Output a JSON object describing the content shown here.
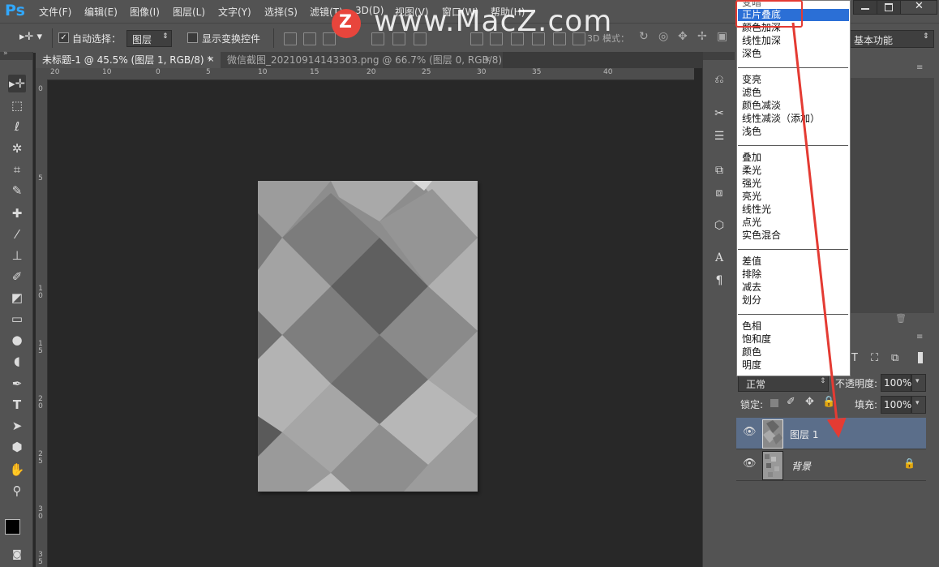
{
  "app": {
    "logo": "Ps"
  },
  "menu": [
    "文件(F)",
    "编辑(E)",
    "图像(I)",
    "图层(L)",
    "文字(Y)",
    "选择(S)",
    "滤镜(T)",
    "3D(D)",
    "视图(V)",
    "窗口(W)",
    "帮助(H)"
  ],
  "options": {
    "auto_select_label": "自动选择：",
    "auto_select_value": "图层",
    "show_transform_label": "显示变换控件",
    "mode_3d_label": "3D 模式：",
    "workspace_value": "基本功能"
  },
  "tabs": [
    {
      "label": "未标题-1 @ 45.5% (图层 1, RGB/8) *",
      "active": true
    },
    {
      "label": "微信截图_20210914143303.png @ 66.7% (图层 0, RGB/8)",
      "active": false
    }
  ],
  "ruler_top": [
    "20",
    "10",
    "0",
    "5",
    "10",
    "15",
    "20",
    "25",
    "30",
    "35",
    "40"
  ],
  "ruler_left": [
    "0",
    "5",
    "1\n0",
    "1\n5",
    "2\n0",
    "2\n5",
    "3\n0",
    "3\n5"
  ],
  "watermark": "www.MacZ.com",
  "watermark_logo": "Z",
  "blend_modes": {
    "partial_top": "变暗",
    "groups": [
      [
        "正片叠底",
        "颜色加深",
        "线性加深",
        "深色"
      ],
      [
        "变亮",
        "滤色",
        "颜色减淡",
        "线性减淡（添加）",
        "浅色"
      ],
      [
        "叠加",
        "柔光",
        "强光",
        "亮光",
        "线性光",
        "点光",
        "实色混合"
      ],
      [
        "差值",
        "排除",
        "减去",
        "划分"
      ],
      [
        "色相",
        "饱和度",
        "颜色",
        "明度"
      ]
    ],
    "selected": "正片叠底"
  },
  "layers_panel": {
    "blend_value": "正常",
    "opacity_label": "不透明度:",
    "opacity_value": "100%",
    "lock_label": "锁定:",
    "fill_label": "填充:",
    "fill_value": "100%",
    "layers": [
      {
        "name": "图层 1",
        "selected": true
      },
      {
        "name": "背景",
        "selected": false,
        "locked": true
      }
    ]
  },
  "colors": {
    "annotation": "#e43b33",
    "selection": "#2b6fd6",
    "ps_blue": "#31a8ff"
  }
}
